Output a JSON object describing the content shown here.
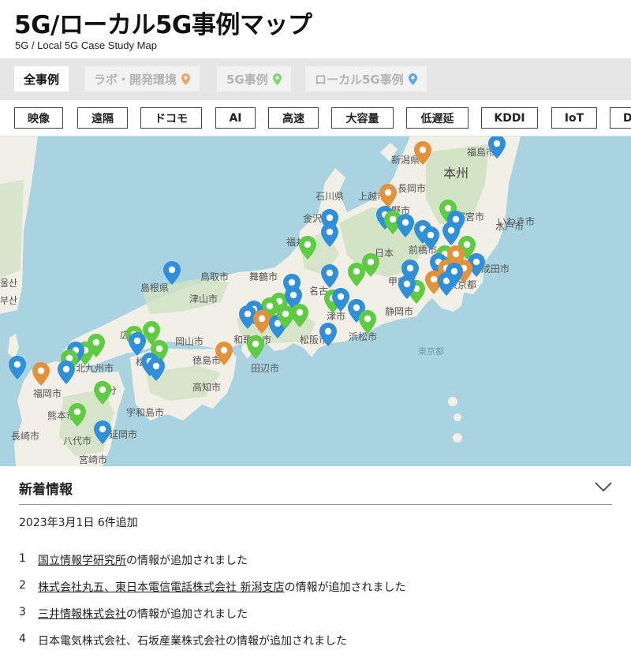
{
  "header": {
    "title": "5G/ローカル5G事例マップ",
    "subtitle": "5G / Local 5G Case Study Map"
  },
  "tabs": [
    {
      "label": "全事例",
      "active": true
    },
    {
      "label": "ラボ・開発環境",
      "pin_color": "#e3923b",
      "active": false
    },
    {
      "label": "5G事例",
      "pin_color": "#5fcb43",
      "active": false
    },
    {
      "label": "ローカル5G事例",
      "pin_color": "#2f8fd8",
      "active": false
    }
  ],
  "filters": [
    "映像",
    "遠隔",
    "ドコモ",
    "AI",
    "高速",
    "大容量",
    "低遅延",
    "KDDI",
    "IoT",
    "D"
  ],
  "map": {
    "colors": {
      "sea": "#a9d3e0",
      "land": "#f1efe6",
      "mountain": "#cfe2c2",
      "blue": "#2f8fd8",
      "green": "#5fcb43",
      "orange": "#e3923b"
    },
    "labels": {
      "fukushima": "福島市",
      "hon": "本州",
      "iwaki": "いわき市",
      "nagaoka": "長岡市",
      "niigata": "新潟県",
      "joetsu": "上越市",
      "ishikawa": "石川県",
      "kanazawa": "金沢市",
      "nagano": "長野市",
      "utsunomiya": "宇都宮市",
      "mito": "水戸市",
      "maebashi": "前橋市",
      "fukui": "福井市",
      "nihon": "日本",
      "narita": "成田市",
      "tokyo": "東京都",
      "kofu": "甲府市",
      "shimane": "島根県",
      "tottori": "鳥取市",
      "maizuru": "舞鶴市",
      "nagoya": "名古",
      "tsuyama": "津山市",
      "wakayama": "和歌山市",
      "tsu": "津市",
      "shizuoka": "静岡市",
      "hamamatsu": "浜松市",
      "okayama": "岡山市",
      "matsusaka": "松阪市",
      "tokushima": "徳島市",
      "tanabe": "田辺市",
      "kochi": "高知市",
      "kitakyushu": "北九州市",
      "fukuoka": "福岡市",
      "kumamoto": "熊本市",
      "uwajima": "宇和島市",
      "oita": "大分",
      "nagasaki": "長崎市",
      "yatsushiro": "八代市",
      "nobeoka": "延岡市",
      "miyazaki": "宮崎市",
      "matsue": "松",
      "hiroshima": "広",
      "ulsan": "울산",
      "busan": "부산",
      "tokaido": "東京都"
    }
  },
  "news": {
    "title": "新着情報",
    "date": "2023年3月1日 6件追加",
    "items": [
      {
        "num": "1",
        "link": "国立情報学研究所",
        "rest": "の情報が追加されました"
      },
      {
        "num": "2",
        "link": "株式会社丸五、東日本電信電話株式会社 新潟支店",
        "rest": "の情報が追加されました"
      },
      {
        "num": "3",
        "link": "三井情報株式会社",
        "rest": "の情報が追加されました"
      },
      {
        "num": "4",
        "link": "",
        "rest": "日本電気株式会社、石坂産業株式会社の情報が追加されました"
      }
    ]
  }
}
